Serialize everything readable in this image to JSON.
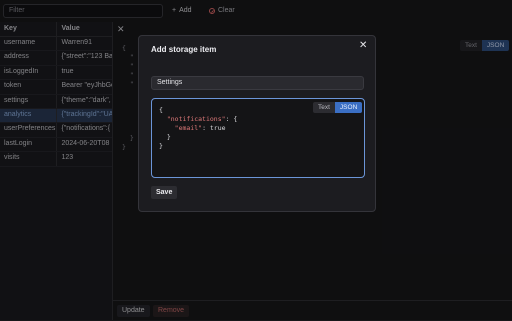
{
  "toolbar": {
    "filter_placeholder": "Filter",
    "add_label": "Add",
    "clear_label": "Clear"
  },
  "table": {
    "headers": [
      "Key",
      "Value"
    ],
    "rows": [
      {
        "key": "username",
        "value": "Warren91"
      },
      {
        "key": "address",
        "value": "{\"street\":\"123 Ba"
      },
      {
        "key": "isLoggedIn",
        "value": "true"
      },
      {
        "key": "token",
        "value": "Bearer \"eyJhbGci"
      },
      {
        "key": "settings",
        "value": "{\"theme\":\"dark\","
      },
      {
        "key": "analytics",
        "value": "{\"trackingId\":\"UA"
      },
      {
        "key": "userPreferences",
        "value": "{\"notifications\":{"
      },
      {
        "key": "lastLogin",
        "value": "2024-06-20T08"
      },
      {
        "key": "visits",
        "value": "123"
      }
    ],
    "selected_index": 5
  },
  "detail": {
    "close_glyph": "✕",
    "toggle_text": "Text",
    "toggle_json": "JSON",
    "code_lines": [
      "{",
      "  \"",
      "  \"",
      "  \"",
      "  \"",
      "",
      "",
      "",
      "",
      "",
      "  }",
      "}"
    ]
  },
  "bottom": {
    "update_label": "Update",
    "remove_label": "Remove"
  },
  "modal": {
    "title": "Add storage item",
    "close_glyph": "✕",
    "name_value": "Settings",
    "toggle_text": "Text",
    "toggle_json": "JSON",
    "code": {
      "line1": "{",
      "key_notifications": "\"notifications\"",
      "line2_rest": ": {",
      "key_email": "\"email\"",
      "line3_rest": ": true",
      "line4": "  }",
      "line5": "}"
    },
    "save_label": "Save"
  },
  "colors": {
    "accent": "#3b6fc4",
    "danger": "#e06a6a",
    "selected_row": "#2a3a55"
  }
}
